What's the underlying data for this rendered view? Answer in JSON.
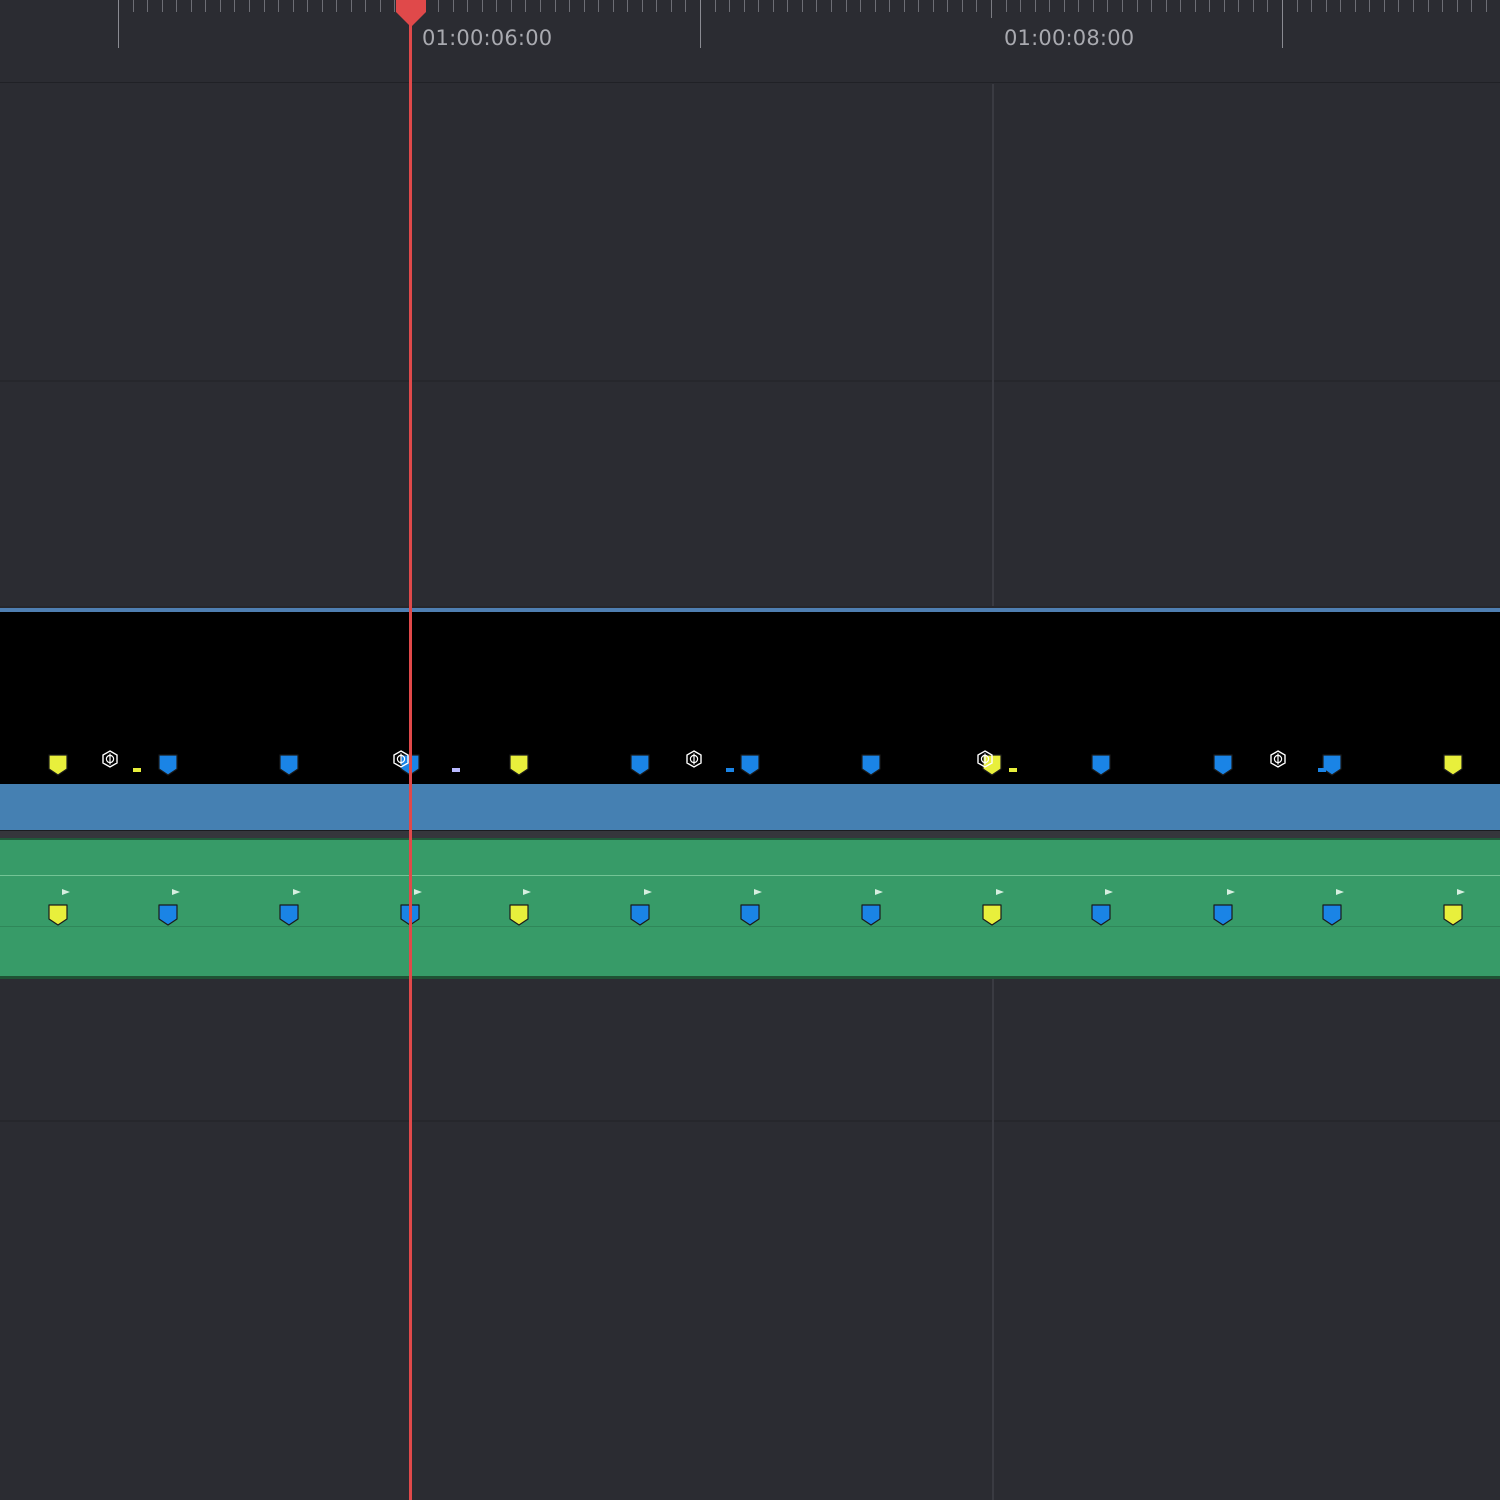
{
  "ruler": {
    "labels": [
      "01:00:06:00",
      "01:00:08:00"
    ]
  },
  "colors": {
    "background": "#2b2c32",
    "playhead": "#e0494a",
    "video_clip": "#4580b2",
    "audio_clip": "#379b68",
    "marker_yellow": "#e8ef3c",
    "marker_blue": "#1a84e6"
  },
  "icons": {
    "playhead": "playhead-triangle-icon",
    "marker": "marker-flag-icon",
    "retime": "retime-hexagon-icon"
  },
  "video_markers": [
    "yellow",
    "blue",
    "blue",
    "blue",
    "yellow",
    "blue",
    "blue",
    "blue",
    "yellow",
    "blue",
    "blue",
    "blue",
    "yellow"
  ],
  "audio_markers": [
    "yellow",
    "blue",
    "blue",
    "blue",
    "yellow",
    "blue",
    "blue",
    "blue",
    "yellow",
    "blue",
    "blue",
    "blue",
    "yellow"
  ]
}
